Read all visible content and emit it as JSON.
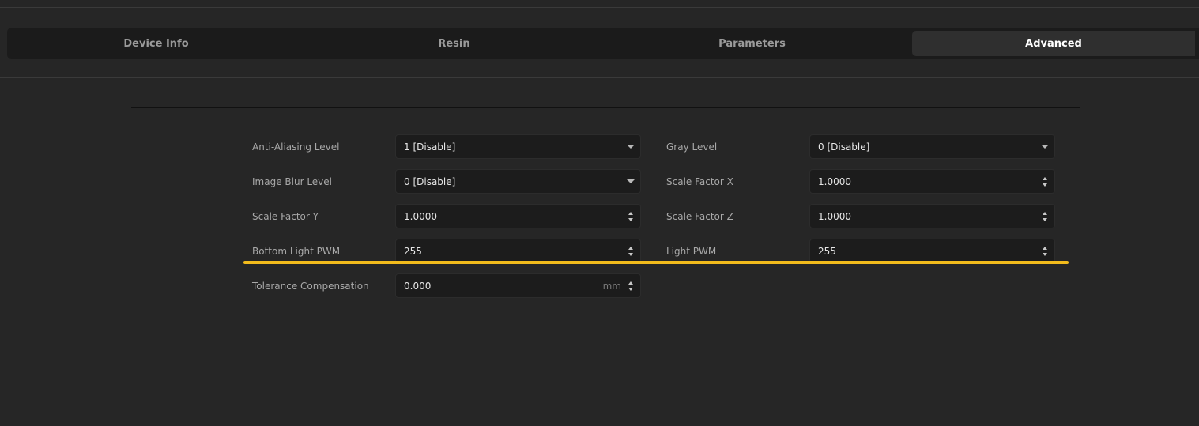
{
  "tabs": [
    {
      "label": "Device Info",
      "active": false
    },
    {
      "label": "Resin",
      "active": false
    },
    {
      "label": "Parameters",
      "active": false
    },
    {
      "label": "Advanced",
      "active": true
    }
  ],
  "fields": {
    "anti_aliasing": {
      "label": "Anti-Aliasing Level",
      "value": "1 [Disable]",
      "control": "dropdown"
    },
    "gray_level": {
      "label": "Gray Level",
      "value": "0 [Disable]",
      "control": "dropdown"
    },
    "image_blur": {
      "label": "Image Blur Level",
      "value": "0 [Disable]",
      "control": "dropdown"
    },
    "scale_x": {
      "label": "Scale Factor X",
      "value": "1.0000",
      "control": "spinbox"
    },
    "scale_y": {
      "label": "Scale Factor Y",
      "value": "1.0000",
      "control": "spinbox"
    },
    "scale_z": {
      "label": "Scale Factor Z",
      "value": "1.0000",
      "control": "spinbox"
    },
    "bottom_light_pwm": {
      "label": "Bottom Light PWM",
      "value": "255",
      "control": "spinbox"
    },
    "light_pwm": {
      "label": "Light PWM",
      "value": "255",
      "control": "spinbox"
    },
    "tolerance": {
      "label": "Tolerance Compensation",
      "value": "0.000",
      "unit": "mm",
      "control": "spinbox"
    }
  },
  "colors": {
    "background": "#262626",
    "highlight": "#f2bb1c",
    "active_tab_text": "#ffffff"
  }
}
